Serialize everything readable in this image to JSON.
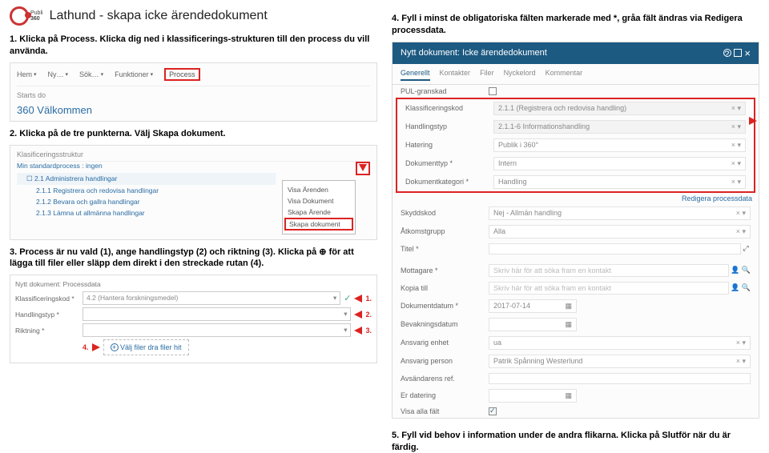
{
  "logo": {
    "top": "Publi",
    "bottom": "360"
  },
  "title": "Lathund - skapa icke ärendedokument",
  "step1": {
    "heading": "1. Klicka på Process. Klicka dig ned i klassificerings-strukturen till den process du vill använda.",
    "toolbar": {
      "hem": "Hem",
      "ny": "Ny…",
      "sok": "Sök…",
      "funk": "Funktioner",
      "process": "Process"
    },
    "starts": "Starts do",
    "welcome": "360 Välkommen"
  },
  "step2": {
    "heading": "2. Klicka på de tre punkterna. Välj Skapa dokument.",
    "kls": "Klasificeringsstruktur",
    "std": "Min standardprocess : ingen",
    "tree": {
      "a": "2.1 Administrera handlingar",
      "b": "2.1.1 Registrera och redovisa handlingar",
      "c": "2.1.2 Bevara och gallra handlingar",
      "d": "2.1.3 Lämna ut allmänna handlingar"
    },
    "menu": {
      "a": "Visa Ärenden",
      "b": "Visa Dokument",
      "c": "Skapa Ärende",
      "d": "Skapa dokument"
    }
  },
  "step3": {
    "heading": "3. Process är nu vald (1), ange handlingstyp (2) och riktning (3). Klicka på ⊕ för att lägga till filer eller släpp dem direkt i den streckade rutan (4).",
    "hdr": "Nytt dokument: Processdata",
    "proc_lab": "Klassificeringskod *",
    "proc_val": "4.2 (Hantera forskningsmedel)",
    "typ_lab": "Handlingstyp *",
    "rik_lab": "Riktning *",
    "num1": "1.",
    "num2": "2.",
    "num3": "3.",
    "num4": "4.",
    "add": "Välj filer dra filer hit"
  },
  "step4": {
    "heading": "4. Fyll i minst de obligatoriska fälten markerade med *, gråa fält ändras via Redigera processdata.",
    "doc_title": "Nytt dokument: Icke ärendedokument",
    "tabs": {
      "a": "Generellt",
      "b": "Kontakter",
      "c": "Filer",
      "d": "Nyckelord",
      "e": "Kommentar"
    },
    "edit": "Redigera processdata",
    "rows": {
      "pul_lab": "PUL-granskad",
      "kk_lab": "Klassificeringskod",
      "kk_val": "2.1.1 (Registrera och redovisa handling)",
      "ht_lab": "Handlingstyp",
      "ht_val": "2.1.1-6 Informationshandling",
      "hat_lab": "Hatering",
      "hat_val": "Publik i 360°",
      "dt_lab": "Dokumenttyp *",
      "dt_val": "Intern",
      "dk_lab": "Dokumentkategori *",
      "dk_val": "Handling",
      "sk_lab": "Skyddskod",
      "sk_val": "Nej - Allmän handling",
      "ak_lab": "Åtkomstgrupp",
      "ak_val": "Alla",
      "ti_lab": "Titel *",
      "mo_lab": "Mottagare *",
      "mo_ph": "Skriv här för att söka fram en kontakt",
      "ko_lab": "Kopia till",
      "ko_ph": "Skriv här för att söka fram en kontakt",
      "dd_lab": "Dokumentdatum *",
      "dd_val": "2017-07-14",
      "bd_lab": "Bevakningsdatum",
      "ae_lab": "Ansvarig enhet",
      "ae_val": "ua",
      "ap_lab": "Ansvarig person",
      "ap_val": "Patrik Spånning Westerlund",
      "av_lab": "Avsändarens ref.",
      "ed_lab": "Er datering",
      "vf_lab": "Visa alla fält"
    }
  },
  "step5": {
    "heading": "5. Fyll vid behov i information under de andra flikarna. Klicka på Slutför när du är färdig."
  }
}
